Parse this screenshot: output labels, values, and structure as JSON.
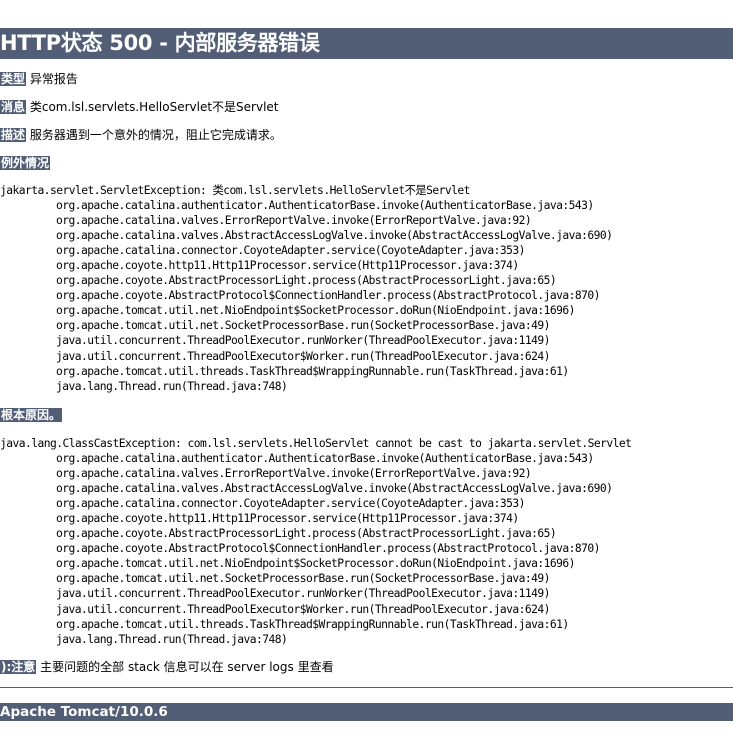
{
  "page": {
    "title": "HTTP状态 500 - 内部服务器错误",
    "type_label": "类型",
    "type_value": "异常报告",
    "message_label": "消息",
    "message_value": "类com.lsl.servlets.HelloServlet不是Servlet",
    "description_label": "描述",
    "description_value": "服务器遇到一个意外的情况，阻止它完成请求。",
    "exception_heading": "例外情况",
    "exception": {
      "head": "jakarta.servlet.ServletException: 类com.lsl.servlets.HelloServlet不是Servlet",
      "frames": [
        "org.apache.catalina.authenticator.AuthenticatorBase.invoke(AuthenticatorBase.java:543)",
        "org.apache.catalina.valves.ErrorReportValve.invoke(ErrorReportValve.java:92)",
        "org.apache.catalina.valves.AbstractAccessLogValve.invoke(AbstractAccessLogValve.java:690)",
        "org.apache.catalina.connector.CoyoteAdapter.service(CoyoteAdapter.java:353)",
        "org.apache.coyote.http11.Http11Processor.service(Http11Processor.java:374)",
        "org.apache.coyote.AbstractProcessorLight.process(AbstractProcessorLight.java:65)",
        "org.apache.coyote.AbstractProtocol$ConnectionHandler.process(AbstractProtocol.java:870)",
        "org.apache.tomcat.util.net.NioEndpoint$SocketProcessor.doRun(NioEndpoint.java:1696)",
        "org.apache.tomcat.util.net.SocketProcessorBase.run(SocketProcessorBase.java:49)",
        "java.util.concurrent.ThreadPoolExecutor.runWorker(ThreadPoolExecutor.java:1149)",
        "java.util.concurrent.ThreadPoolExecutor$Worker.run(ThreadPoolExecutor.java:624)",
        "org.apache.tomcat.util.threads.TaskThread$WrappingRunnable.run(TaskThread.java:61)",
        "java.lang.Thread.run(Thread.java:748)"
      ]
    },
    "root_cause_heading": "根本原因。",
    "root_cause": {
      "head": "java.lang.ClassCastException: com.lsl.servlets.HelloServlet cannot be cast to jakarta.servlet.Servlet",
      "frames": [
        "org.apache.catalina.authenticator.AuthenticatorBase.invoke(AuthenticatorBase.java:543)",
        "org.apache.catalina.valves.ErrorReportValve.invoke(ErrorReportValve.java:92)",
        "org.apache.catalina.valves.AbstractAccessLogValve.invoke(AbstractAccessLogValve.java:690)",
        "org.apache.catalina.connector.CoyoteAdapter.service(CoyoteAdapter.java:353)",
        "org.apache.coyote.http11.Http11Processor.service(Http11Processor.java:374)",
        "org.apache.coyote.AbstractProcessorLight.process(AbstractProcessorLight.java:65)",
        "org.apache.coyote.AbstractProtocol$ConnectionHandler.process(AbstractProtocol.java:870)",
        "org.apache.tomcat.util.net.NioEndpoint$SocketProcessor.doRun(NioEndpoint.java:1696)",
        "org.apache.tomcat.util.net.SocketProcessorBase.run(SocketProcessorBase.java:49)",
        "java.util.concurrent.ThreadPoolExecutor.runWorker(ThreadPoolExecutor.java:1149)",
        "java.util.concurrent.ThreadPoolExecutor$Worker.run(ThreadPoolExecutor.java:624)",
        "org.apache.tomcat.util.threads.TaskThread$WrappingRunnable.run(TaskThread.java:61)",
        "java.lang.Thread.run(Thread.java:748)"
      ]
    },
    "note_label": "):注意",
    "note_value": "主要问题的全部 stack 信息可以在 server logs 里查看",
    "footer": "Apache Tomcat/10.0.6"
  },
  "colors": {
    "header_bg": "#525d76",
    "header_fg": "#ffffff",
    "text": "#000000",
    "background": "#ffffff"
  }
}
